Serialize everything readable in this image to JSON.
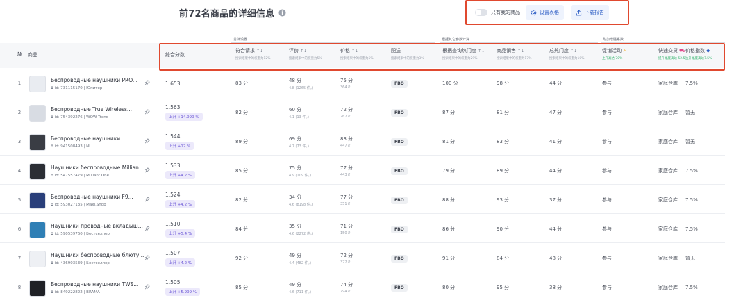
{
  "header": {
    "title": "前72名商品的详细信息",
    "toggle_label": "只有我的商品",
    "settings_button": "设置表格",
    "download_button": "下载报告"
  },
  "groups": [
    "总体设置",
    "根据其它参数计算",
    "附加增强系数"
  ],
  "columns": {
    "num": "№",
    "product": "商品",
    "score": "综合分数",
    "demand": {
      "label": "符合请求",
      "sub": "搜索结果中的权重为12%"
    },
    "rating": {
      "label": "评价",
      "sub": "搜索结果中的权重为5%"
    },
    "price": {
      "label": "价格",
      "sub": "搜索结果中的权重为5%"
    },
    "delivery": {
      "label": "配送",
      "sub": "搜索结果中的权重为3%"
    },
    "search_popularity": {
      "label": "根据查询热门度",
      "sub": "搜索结果中的权重为29%"
    },
    "sales": {
      "label": "商品销售",
      "sub": "搜索结果中的权重为17%"
    },
    "popularity": {
      "label": "总热门度",
      "sub": "搜索结果中的权重为10%"
    },
    "promo": {
      "label": "促销活动",
      "sub": "上升高达 70%"
    },
    "fast_delivery": {
      "label": "快速交货",
      "sub": "提升幅度高达 52.5%"
    },
    "price_index": {
      "label": "价格指数",
      "sub": "上升幅度高达7.5%"
    }
  },
  "rows": [
    {
      "num": "1",
      "name": "Беспроводные наушники PRO...",
      "id": "id: 731115170",
      "seller": "Юпитер",
      "score": "1.653",
      "score_tag": "",
      "demand": "83 分",
      "rating": "48 分",
      "rating_sub": "4.8 (1265 件。)",
      "price": "75 分",
      "price_sub": "364 ₽",
      "delivery": "FBO",
      "search_pop": "100 分",
      "sales": "98 分",
      "popularity": "44 分",
      "promo": "参与",
      "fast": "家庭仓库",
      "price_index": "7.5%",
      "thumb_color": "#e9ecf1"
    },
    {
      "num": "2",
      "name": "Беспроводные True Wireless...",
      "id": "id: 754392276",
      "seller": "WOW Trend",
      "score": "1.563",
      "score_tag": "上升 +14.999 %",
      "demand": "82 分",
      "rating": "60 分",
      "rating_sub": "4.1 (13 件。)",
      "price": "72 分",
      "price_sub": "267 ₽",
      "delivery": "FBO",
      "search_pop": "87 分",
      "sales": "81 分",
      "popularity": "47 分",
      "promo": "参与",
      "fast": "家庭仓库",
      "price_index": "暂无",
      "thumb_color": "#d8dce3"
    },
    {
      "num": "3",
      "name": "Беспроводные наушники...",
      "id": "id: 941508493",
      "seller": "NL",
      "score": "1.544",
      "score_tag": "上升 +12 %",
      "demand": "89 分",
      "rating": "69 分",
      "rating_sub": "4.7 (73 件。)",
      "price": "83 分",
      "price_sub": "447 ₽",
      "delivery": "FBO",
      "search_pop": "81 分",
      "sales": "83 分",
      "popularity": "41 分",
      "promo": "参与",
      "fast": "家庭仓库",
      "price_index": "暂无",
      "thumb_color": "#3a3d44"
    },
    {
      "num": "4",
      "name": "Наушники беспроводные Millian...",
      "id": "id: 547557479",
      "seller": "Milliant One",
      "score": "1.533",
      "score_tag": "上升 +4.2 %",
      "demand": "85 分",
      "rating": "75 分",
      "rating_sub": "4.9 (109 件。)",
      "price": "77 分",
      "price_sub": "443 ₽",
      "delivery": "FBO",
      "search_pop": "79 分",
      "sales": "89 分",
      "popularity": "44 分",
      "promo": "参与",
      "fast": "家庭仓库",
      "price_index": "7.5%",
      "thumb_color": "#2b2e35"
    },
    {
      "num": "5",
      "name": "Беспроводные наушники F9...",
      "id": "id: 593027135",
      "seller": "Maxi.Shop",
      "score": "1.524",
      "score_tag": "上升 +4.2 %",
      "demand": "82 分",
      "rating": "34 分",
      "rating_sub": "4.6 (8198 件。)",
      "price": "77 分",
      "price_sub": "351 ₽",
      "delivery": "FBO",
      "search_pop": "88 分",
      "sales": "93 分",
      "popularity": "37 分",
      "promo": "参与",
      "fast": "家庭仓库",
      "price_index": "7.5%",
      "thumb_color": "#2a3f7a"
    },
    {
      "num": "6",
      "name": "Наушники проводные вкладыш...",
      "id": "id: 590539760",
      "seller": "Бестселлер",
      "score": "1.510",
      "score_tag": "上升 +5.4 %",
      "demand": "84 分",
      "rating": "35 分",
      "rating_sub": "4.6 (2272 件。)",
      "price": "71 分",
      "price_sub": "150 ₽",
      "delivery": "FBO",
      "search_pop": "86 分",
      "sales": "90 分",
      "popularity": "44 分",
      "promo": "参与",
      "fast": "家庭仓库",
      "price_index": "7.5%",
      "thumb_color": "#2f7fb5"
    },
    {
      "num": "7",
      "name": "Наушники беспроводные блюту...",
      "id": "id: 436903539",
      "seller": "Бестселлер",
      "score": "1.507",
      "score_tag": "上升 +4.2 %",
      "demand": "92 分",
      "rating": "49 分",
      "rating_sub": "4.4 (482 件。)",
      "price": "72 分",
      "price_sub": "322 ₽",
      "delivery": "FBO",
      "search_pop": "91 分",
      "sales": "84 分",
      "popularity": "48 分",
      "promo": "参与",
      "fast": "家庭仓库",
      "price_index": "暂无",
      "thumb_color": "#eef0f4"
    },
    {
      "num": "8",
      "name": "Беспроводные наушники TWS...",
      "id": "id: 849222822",
      "seller": "BRAMA",
      "score": "1.505",
      "score_tag": "上升 +5.999 %",
      "demand": "85 分",
      "rating": "49 分",
      "rating_sub": "4.6 (711 件。)",
      "price": "74 分",
      "price_sub": "794 ₽",
      "delivery": "FBO",
      "search_pop": "80 分",
      "sales": "95 分",
      "popularity": "38 分",
      "promo": "参与",
      "fast": "家庭仓库",
      "price_index": "7.5%",
      "thumb_color": "#1f2126"
    }
  ],
  "colors": {
    "accent": "#2f5fc5",
    "highlight_border": "#e0492f",
    "tag_bg": "#ece9fb",
    "tag_text": "#6b57d6",
    "positive": "#2fb36a"
  }
}
